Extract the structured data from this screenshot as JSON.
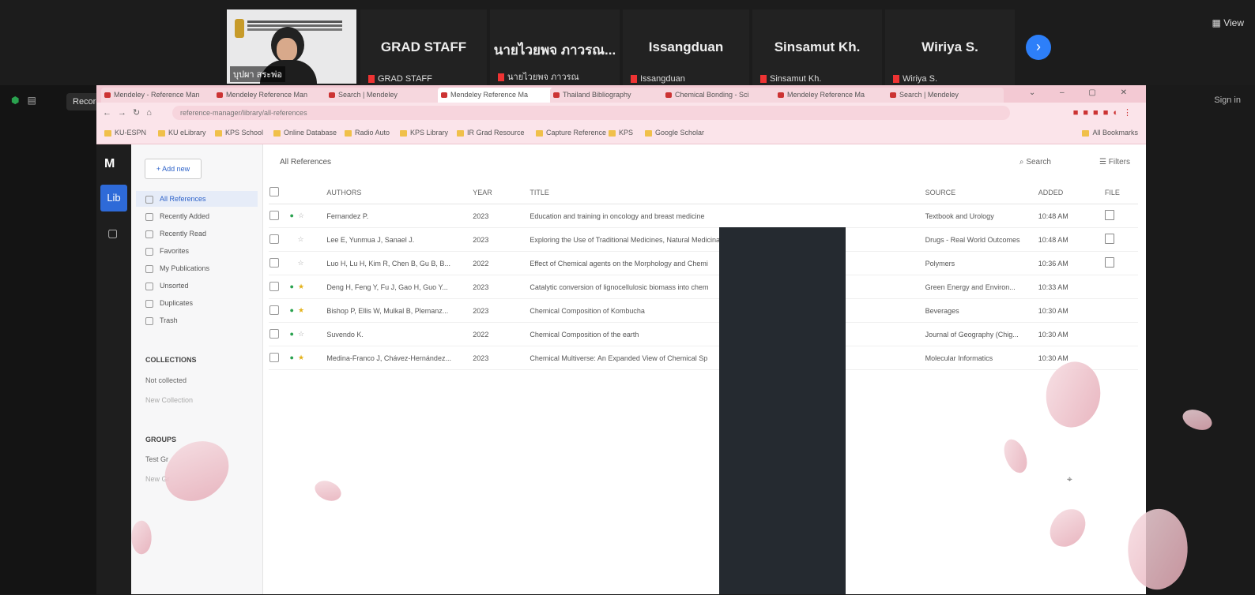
{
  "zoom": {
    "self_caption": "บุปผา สระพ่อ",
    "participants": [
      {
        "name": "GRAD STAFF",
        "sub": "GRAD STAFF"
      },
      {
        "name": "นายไวยพจ ภาวรณ...",
        "sub": "นายไวยพจ ภาวรณ"
      },
      {
        "name": "Issangduan",
        "sub": "Issangduan"
      },
      {
        "name": "Sinsamut Kh.",
        "sub": "Sinsamut Kh."
      },
      {
        "name": "Wiriya S.",
        "sub": "Wiriya S."
      }
    ],
    "view_label": "View",
    "recording_label": "Recording...",
    "sign_in_label": "Sign in"
  },
  "browser": {
    "tabs": [
      {
        "label": "Mendeley - Reference Man"
      },
      {
        "label": "Mendeley Reference Man"
      },
      {
        "label": "Search | Mendeley"
      },
      {
        "label": "Mendeley Reference Ma"
      },
      {
        "label": "Thailand Bibliography"
      },
      {
        "label": "Chemical Bonding - Sci"
      },
      {
        "label": "Mendeley Reference Ma"
      },
      {
        "label": "Search | Mendeley"
      }
    ],
    "url": "reference-manager/library/all-references",
    "bookmarks": [
      "KU-ESPN",
      "KU eLibrary",
      "KPS School",
      "Online Database",
      "Radio Auto",
      "KPS Library",
      "IR Grad Resource",
      "Capture Reference",
      "KPS",
      "Google Scholar"
    ],
    "all_bookmarks": "All Bookmarks"
  },
  "app": {
    "rail_logo": "M",
    "rail_library": "Lib",
    "add_new": "+ Add new",
    "nav_items": [
      {
        "label": "All References",
        "active": true
      },
      {
        "label": "Recently Added",
        "active": false
      },
      {
        "label": "Recently Read",
        "active": false
      },
      {
        "label": "Favorites",
        "active": false
      },
      {
        "label": "My Publications",
        "active": false
      },
      {
        "label": "Unsorted",
        "active": false
      },
      {
        "label": "Duplicates",
        "active": false
      },
      {
        "label": "Trash",
        "active": false
      }
    ],
    "collections_heading": "COLLECTIONS",
    "collections_item": "Not collected",
    "new_collection": "New Collection",
    "groups_heading": "GROUPS",
    "group_item": "Test Gr",
    "new_group": "New Gr",
    "main_title": "All References",
    "search_label": "Search",
    "filter_label": "Filters",
    "columns": [
      "AUTHORS",
      "YEAR",
      "TITLE",
      "SOURCE",
      "ADDED",
      "FILE"
    ],
    "references": [
      {
        "authors": "Fernandez P.",
        "year": "2023",
        "title": "Education and training in oncology and breast medicine",
        "source": "Textbook and Urology",
        "added": "10:48 AM",
        "file": true,
        "dot": true,
        "star": false
      },
      {
        "authors": "Lee E, Yunmua J, Sanael J.",
        "year": "2023",
        "title": "Exploring the Use of Traditional Medicines, Natural Medicinal ... Development a",
        "source": "Drugs - Real World Outcomes",
        "added": "10:48 AM",
        "file": true,
        "dot": false,
        "star": false
      },
      {
        "authors": "Luo H, Lu H, Kim R, Chen B, Gu B, B...",
        "year": "2022",
        "title": "Effect of Chemical agents on the Morphology and Chemi",
        "source": "Polymers",
        "added": "10:36 AM",
        "file": true,
        "dot": false,
        "star": false
      },
      {
        "authors": "Deng H, Feng Y, Fu J, Gao H, Guo Y...",
        "year": "2023",
        "title": "Catalytic conversion of lignocellulosic biomass into chem",
        "source": "Green Energy and Environ...",
        "added": "10:33 AM",
        "file": false,
        "dot": true,
        "star": true
      },
      {
        "authors": "Bishop P, Ellis W, Mulkal B, Plemanz...",
        "year": "2023",
        "title": "Chemical Composition of Kombucha",
        "source": "Beverages",
        "added": "10:30 AM",
        "file": false,
        "dot": true,
        "star": true
      },
      {
        "authors": "Suvendo K.",
        "year": "2022",
        "title": "Chemical Composition of the earth",
        "source": "Journal of Geography (Chig...",
        "added": "10:30 AM",
        "file": false,
        "dot": true,
        "star": false
      },
      {
        "authors": "Medina-Franco J, Chávez-Hernández...",
        "year": "2023",
        "title": "Chemical Multiverse: An Expanded View of Chemical Sp",
        "source": "Molecular Informatics",
        "added": "10:30 AM",
        "file": false,
        "dot": true,
        "star": true
      }
    ]
  }
}
